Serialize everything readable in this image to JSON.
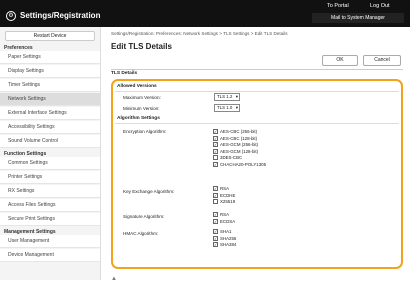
{
  "header": {
    "to_portal": "To Portal",
    "log_out": "Log Out",
    "mail": "Mail to System Manager",
    "title": "Settings/Registration"
  },
  "sidebar": {
    "restart": "Restart Device",
    "sec_prefs": "Preferences",
    "sec_funcs": "Function Settings",
    "sec_mgmt": "Management Settings",
    "items": [
      "Paper Settings",
      "Display Settings",
      "Timer Settings",
      "Network Settings",
      "External Interface Settings",
      "Accessibility Settings",
      "Sound Volume Control",
      "Common Settings",
      "Printer Settings",
      "RX Settings",
      "Access Files Settings",
      "Secure Print Settings",
      "User Management",
      "Device Management"
    ]
  },
  "main": {
    "breadcrumb": "Settings/Registration: Preferences: Network Settings > TLS Settings > Edit TLS Details",
    "title": "Edit TLS Details",
    "ok": "OK",
    "cancel": "Cancel",
    "section": "TLS Details",
    "allowed_versions": "Allowed Versions",
    "max_label": "Maximum Version:",
    "max_value": "TLS 1.2",
    "min_label": "Minimum Version:",
    "min_value": "TLS 1.0",
    "algo_settings": "Algorithm Settings",
    "enc_label": "Encryption Algorithm:",
    "enc": [
      "AES-CBC (256-bit)",
      "AES-CBC (128-bit)",
      "AES-GCM (256-bit)",
      "AES-GCM (128-bit)",
      "3DES-CBC",
      "CHACHA20-POLY1305"
    ],
    "kex_label": "Key Exchange Algorithm:",
    "kex": [
      "RSA",
      "ECDHE",
      "X25519"
    ],
    "sig_label": "Signature Algorithm:",
    "sig": [
      "RSA",
      "ECDSA"
    ],
    "hmac_label": "HMAC Algorithm:",
    "hmac": [
      "SHA1",
      "SHA256",
      "SHA384"
    ],
    "checked": {
      "enc": [
        true,
        true,
        true,
        true,
        false,
        true
      ],
      "kex": [
        true,
        true,
        false
      ],
      "sig": [
        true,
        true
      ],
      "hmac": [
        true,
        true,
        true
      ]
    }
  }
}
